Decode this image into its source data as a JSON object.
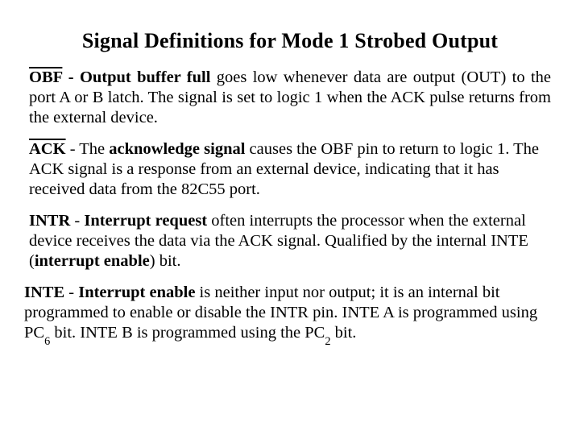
{
  "title": "Signal Definitions for Mode 1 Strobed Output",
  "defs": {
    "obf": {
      "sig": "OBF",
      "name": "Output buffer full",
      "rest": " goes low whenever data are output (OUT) to the port A or B latch. The signal is set to logic 1 when the ACK pulse returns from the external device."
    },
    "ack": {
      "sig": "ACK",
      "pre": " - The ",
      "name": "acknowledge signal",
      "rest": " causes the OBF pin to return to logic 1. The ACK signal is a response from an external device, indicating that it has received data from the 82C55 port."
    },
    "intr": {
      "sig": "INTR",
      "pre": " - ",
      "name": "Interrupt request",
      "rest1": " often interrupts the processor when the external device receives the data via the ACK signal. Qualified by the internal INTE (",
      "paren": "interrupt enable",
      "rest2": ") bit."
    },
    "inte": {
      "sig": "INTE",
      "pre": " - ",
      "name": "Interrupt enable",
      "rest1": " is neither input nor output; it is an internal bit programmed to enable or disable the INTR pin. INTE A is programmed using PC",
      "sub1": "6",
      "rest2": " bit. INTE B is programmed using the PC",
      "sub2": "2",
      "rest3": " bit."
    }
  }
}
